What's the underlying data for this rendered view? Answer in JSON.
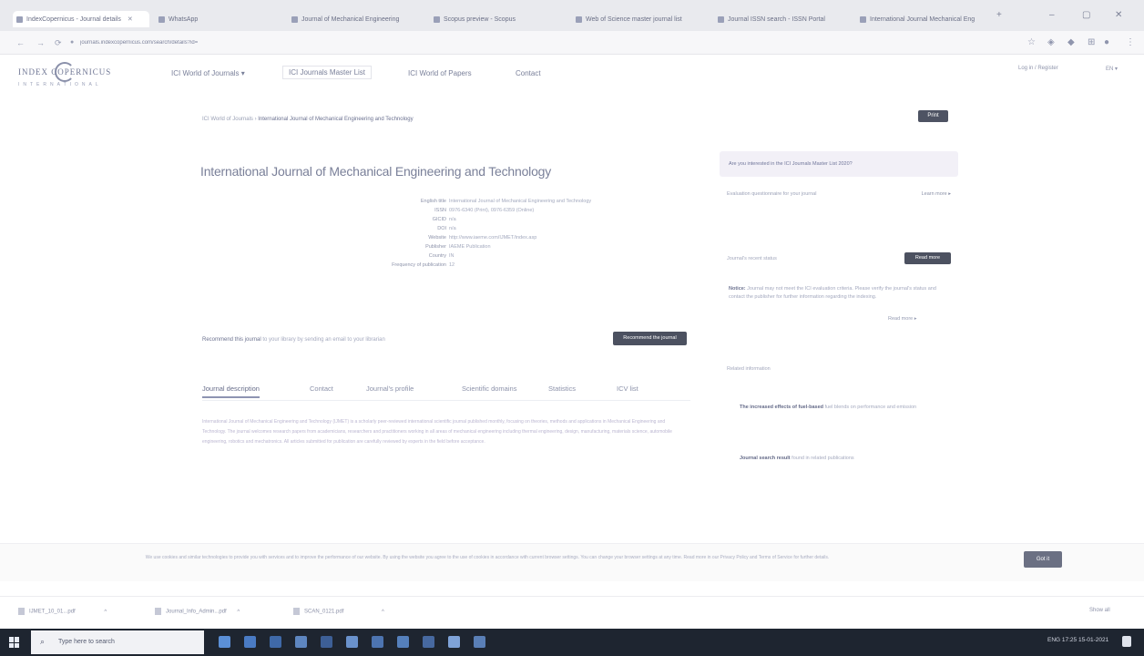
{
  "browser": {
    "tabs": [
      {
        "label": "IndexCopernicus - Journal details"
      },
      {
        "label": "WhatsApp"
      },
      {
        "label": "Journal of Mechanical Engineering"
      },
      {
        "label": "Scopus preview - Scopus"
      },
      {
        "label": "Web of Science master journal list"
      },
      {
        "label": "Journal ISSN search - ISSN Portal"
      },
      {
        "label": "International Journal Mechanical Eng"
      }
    ],
    "url": "journals.indexcopernicus.com/search/details?id=",
    "window_controls": [
      "–",
      "▢",
      "✕"
    ]
  },
  "site": {
    "logo_text": "INDEX COPERNICUS",
    "logo_sub": "INTERNATIONAL",
    "nav": [
      "ICI World of Journals ▾",
      "ICI Journals Master List",
      "ICI World of Papers",
      "Contact"
    ],
    "login": "Log in / Register",
    "lang": "EN ▾"
  },
  "breadcrumb": {
    "home": "ICI World of Journals",
    "current": "International Journal of Mechanical Engineering and Technology"
  },
  "print_label": "Print",
  "journal": {
    "title": "International Journal of Mechanical Engineering and Technology",
    "info": [
      {
        "k": "English title",
        "v": "International Journal of Mechanical Engineering and Technology"
      },
      {
        "k": "ISSN",
        "v": "0976-6340 (Print), 0976-6359 (Online)"
      },
      {
        "k": "GICID",
        "v": "n/a"
      },
      {
        "k": "DOI",
        "v": "n/a"
      },
      {
        "k": "Website",
        "v": "http://www.iaeme.com/IJMET/index.asp"
      },
      {
        "k": "Publisher",
        "v": "IAEME Publication"
      },
      {
        "k": "Country",
        "v": "IN"
      },
      {
        "k": "Frequency of publication",
        "v": "12"
      }
    ]
  },
  "recommend": {
    "lead": "Recommend this journal",
    "text": "to your library by sending an email to your librarian",
    "button": "Recommend the journal"
  },
  "content_tabs": [
    "Journal description",
    "Contact",
    "Journal's profile",
    "Scientific domains",
    "Statistics",
    "ICV list"
  ],
  "description": "International Journal of Mechanical Engineering and Technology (IJMET) is a scholarly peer-reviewed international scientific journal published monthly, focusing on theories, methods and applications in Mechanical Engineering and Technology. The journal welcomes research papers from academicians, researchers and practitioners working in all areas of mechanical engineering including thermal engineering, design, manufacturing, materials science, automobile engineering, robotics and mechatronics. All articles submitted for publication are carefully reviewed by experts in the field before acceptance.",
  "sidebar": {
    "banner": "Are you interested in the ICI Journals Master List 2020?",
    "link_left": "Evaluation questionnaire for your journal",
    "link_right": "Learn more ▸",
    "section_label": "Journal's recent status",
    "section_button": "Read more",
    "note_bold": "Notice:",
    "note_text": "Journal may not meet the ICI evaluation criteria. Please verify the journal's status and contact the publisher for further information regarding the indexing.",
    "note_more": "Read more ▸",
    "related_label": "Related information",
    "related": [
      {
        "bold": "The increased effects of fuel-based",
        "text": "fuel blends on performance and emission"
      },
      {
        "bold": "Journal search result",
        "text": "found in related publications"
      }
    ]
  },
  "cookie": {
    "text": "We use cookies and similar technologies to provide you with services and to improve the performance of our website. By using the website you agree to the use of cookies in accordance with current browser settings. You can change your browser settings at any time. Read more in our Privacy Policy and Terms of Service for further details.",
    "button": "Got it"
  },
  "downloads": [
    {
      "label": "IJMET_10_01...pdf"
    },
    {
      "label": "Journal_Info_Admin...pdf"
    },
    {
      "label": "SCAN_0121.pdf"
    }
  ],
  "downloads_show_all": "Show all",
  "taskbar": {
    "search_placeholder": "Type here to search",
    "tray": "ENG  17:25  15-01-2021"
  }
}
